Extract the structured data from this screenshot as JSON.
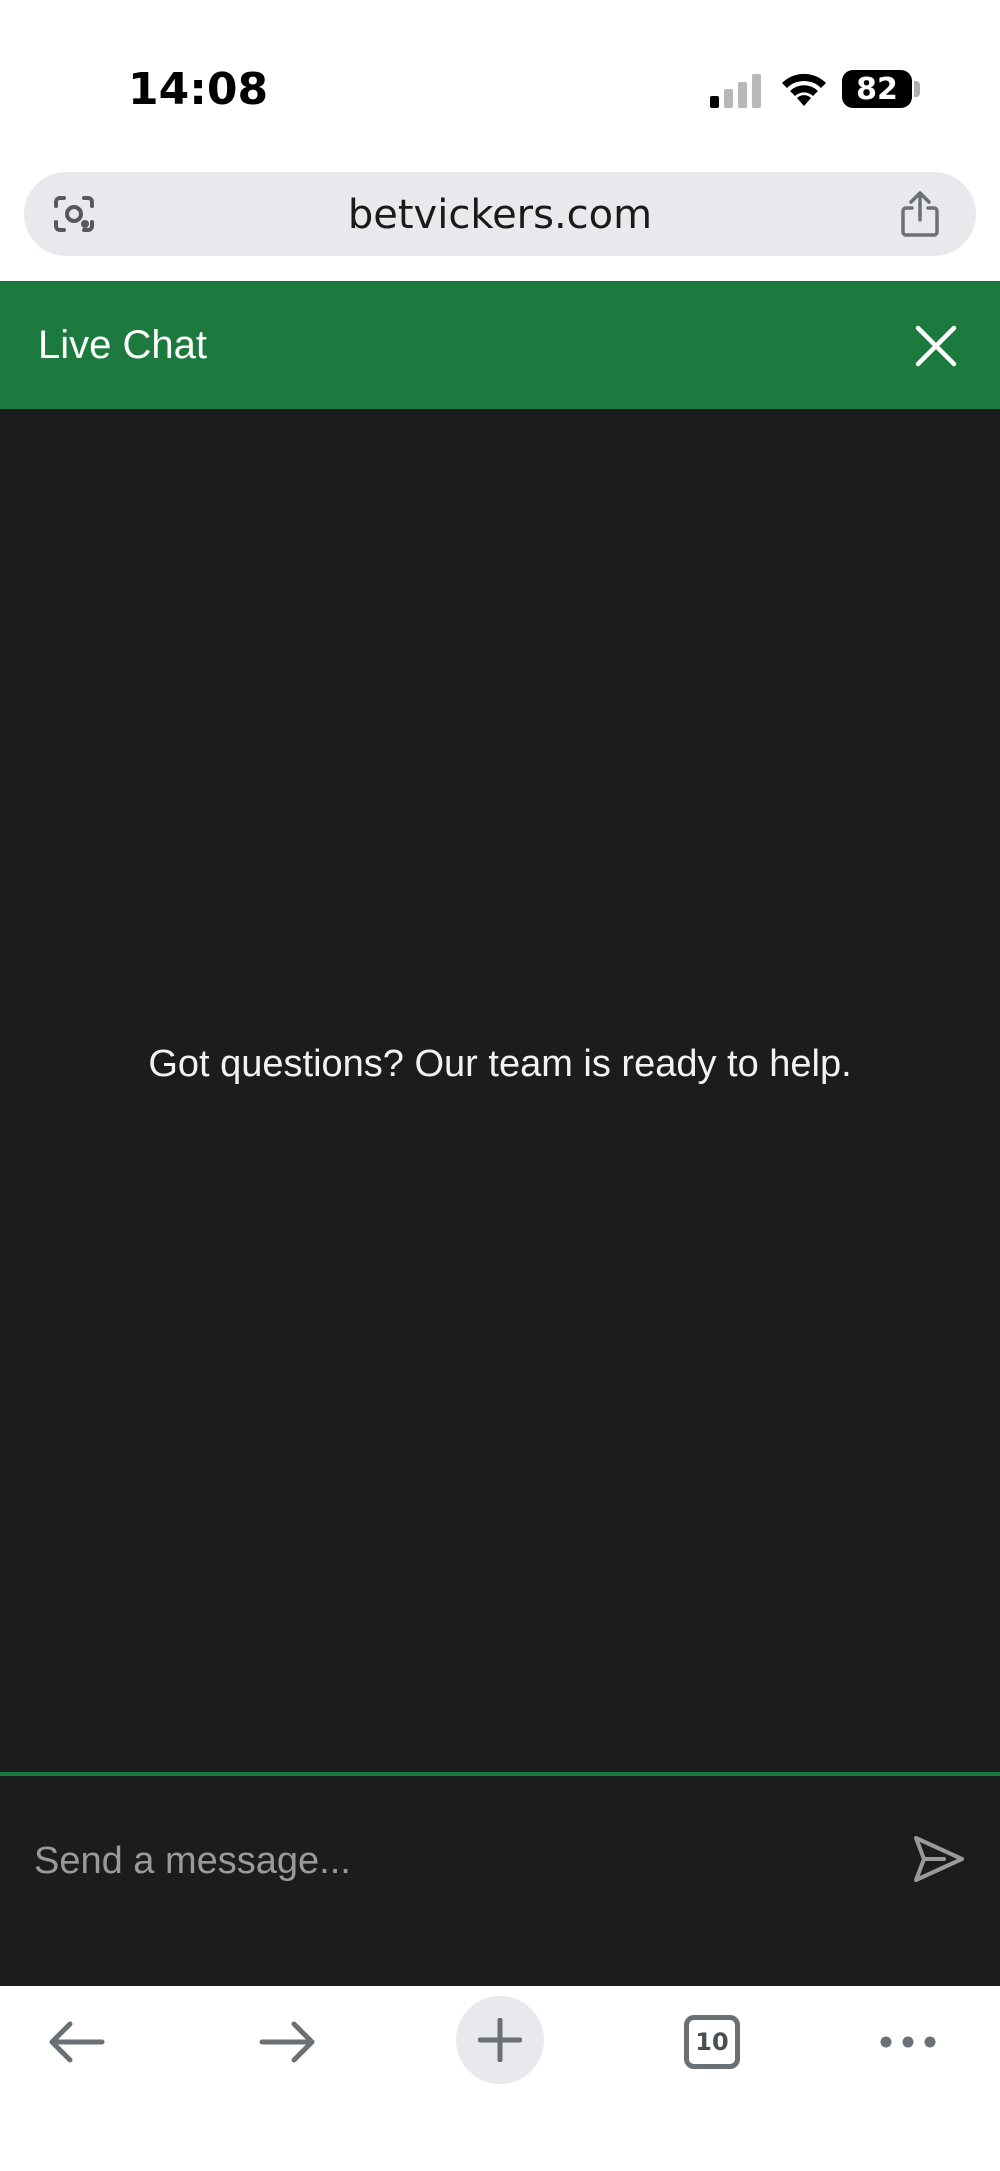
{
  "status_bar": {
    "time": "14:08",
    "battery": "82",
    "signal_icon": "cellular-signal-icon",
    "wifi_icon": "wifi-icon"
  },
  "address_bar": {
    "url": "betvickers.com",
    "left_icon": "lens-icon",
    "right_icon": "share-icon"
  },
  "chat": {
    "title": "Live Chat",
    "close_icon": "close-icon",
    "empty_message": "Got questions? Our team is ready to help.",
    "input_placeholder": "Send a message...",
    "input_value": "",
    "send_icon": "send-icon"
  },
  "toolbar": {
    "back_icon": "back-arrow-icon",
    "forward_icon": "forward-arrow-icon",
    "new_tab_icon": "plus-icon",
    "tab_count": "10",
    "more_icon": "more-dots-icon"
  },
  "colors": {
    "header_green": "#1c7a3e",
    "chat_background": "#1b1c1e",
    "address_bar_bg": "#e7e9ec"
  }
}
